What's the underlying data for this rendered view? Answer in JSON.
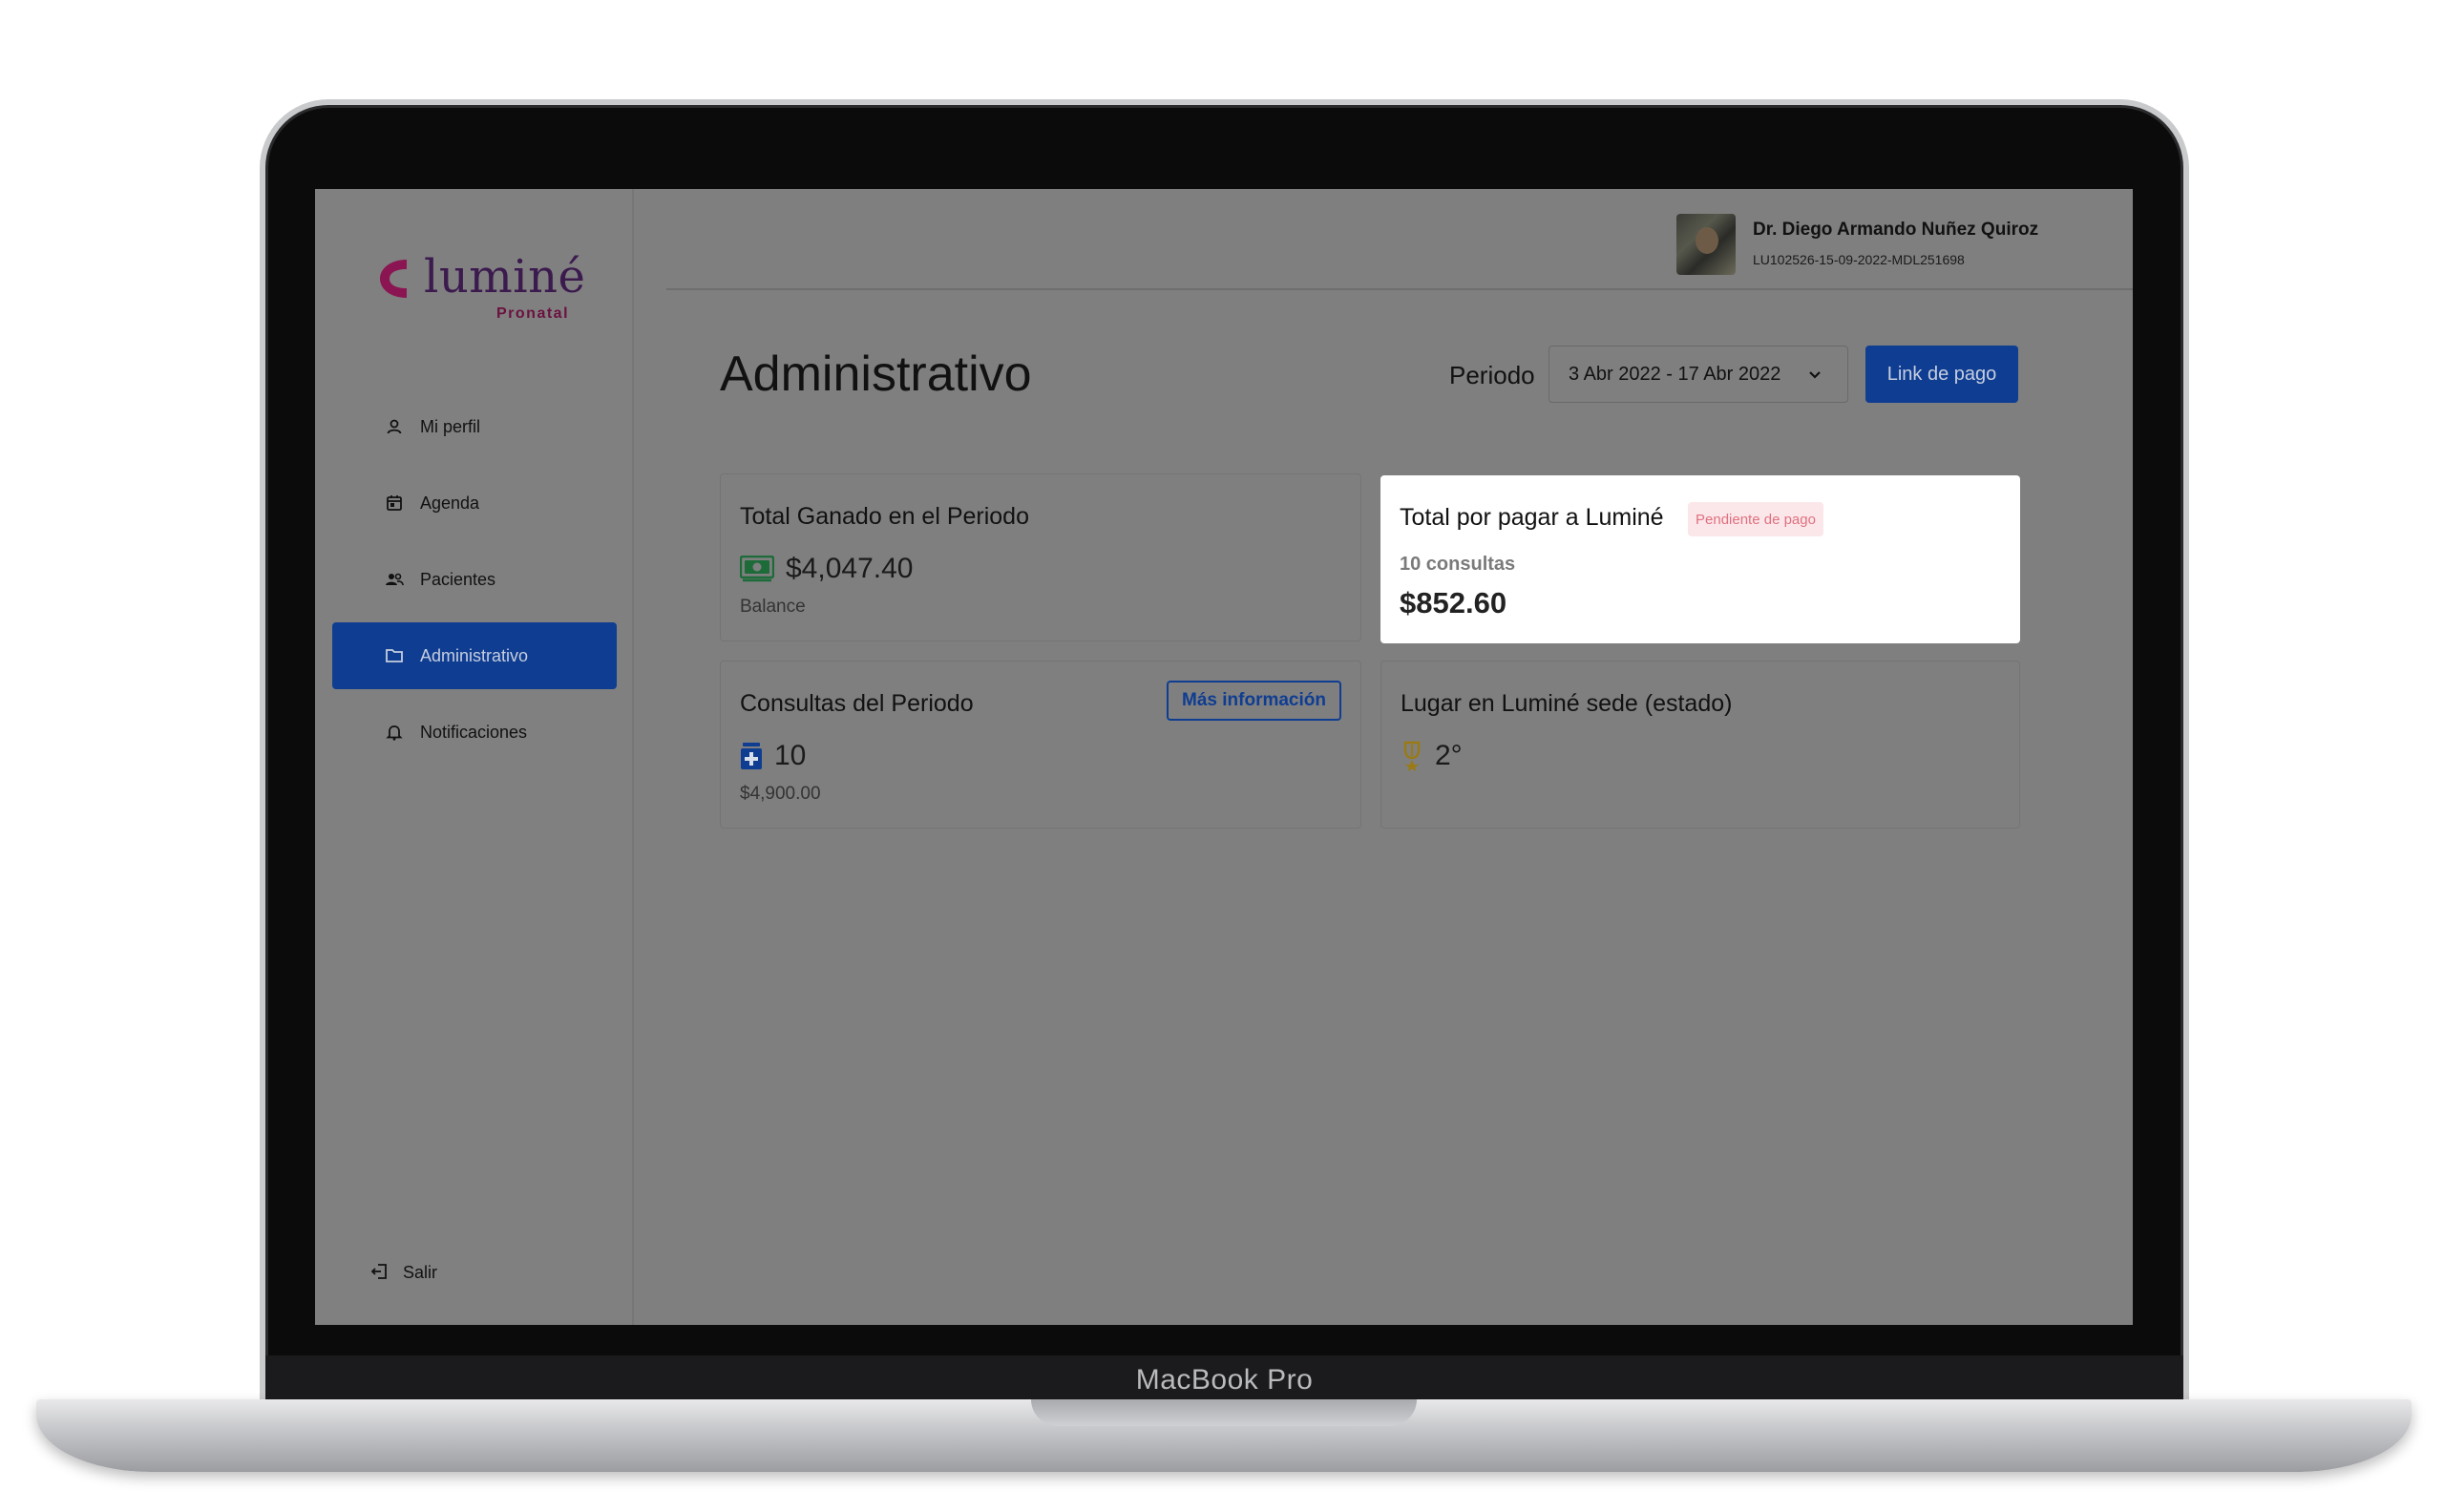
{
  "device": {
    "label": "MacBook Pro"
  },
  "brand": {
    "name": "luminé",
    "subtitle": "Pronatal",
    "colors": {
      "accent": "#0f3d92",
      "logo": "#8a1552"
    }
  },
  "sidebar": {
    "items": [
      {
        "label": "Mi perfil",
        "icon": "user-icon"
      },
      {
        "label": "Agenda",
        "icon": "calendar-icon"
      },
      {
        "label": "Pacientes",
        "icon": "users-icon"
      },
      {
        "label": "Administrativo",
        "icon": "folder-icon",
        "active": true
      },
      {
        "label": "Notificaciones",
        "icon": "bell-icon"
      }
    ],
    "logout": {
      "label": "Salir",
      "icon": "logout-icon"
    }
  },
  "header": {
    "user_name": "Dr. Diego Armando Nuñez Quiroz",
    "user_id": "LU102526-15-09-2022-MDL251698"
  },
  "main": {
    "title": "Administrativo",
    "period_label": "Periodo",
    "period_value": "3 Abr 2022 - 17 Abr 2022",
    "pay_link_label": "Link de pago"
  },
  "cards": {
    "earned": {
      "title": "Total Ganado en el Periodo",
      "value": "$4,047.40",
      "sub": "Balance",
      "icon": "cash-icon"
    },
    "to_pay": {
      "title": "Total por pagar a Luminé",
      "badge": "Pendiente de pago",
      "count": "10 consultas",
      "amount": "$852.60"
    },
    "consultations": {
      "title": "Consultas del Periodo",
      "button": "Más información",
      "value": "10",
      "sub": "$4,900.00",
      "icon": "medical-icon"
    },
    "rank": {
      "title": "Lugar en Luminé sede (estado)",
      "value": "2°",
      "icon": "trophy-icon"
    }
  }
}
